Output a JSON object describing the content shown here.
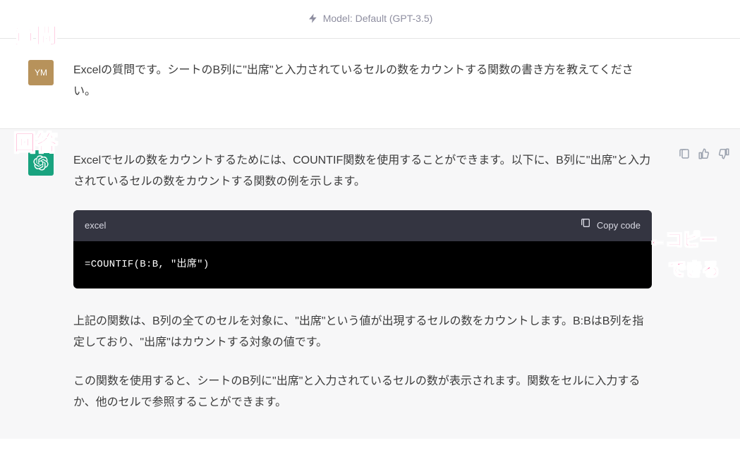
{
  "model_bar": {
    "label": "Model: Default (GPT-3.5)"
  },
  "user": {
    "avatar_text": "YM",
    "message": "Excelの質問です。シートのB列に\"出席\"と入力されているセルの数をカウントする関数の書き方を教えてください。"
  },
  "assistant": {
    "p1": "Excelでセルの数をカウントするためには、COUNTIF関数を使用することができます。以下に、B列に\"出席\"と入力されているセルの数をカウントする関数の例を示します。",
    "code": {
      "lang": "excel",
      "copy_label": "Copy code",
      "content": "=COUNTIF(B:B, \"出席\")"
    },
    "p2": "上記の関数は、B列の全てのセルを対象に、\"出席\"という値が出現するセルの数をカウントします。B:BはB列を指定しており、\"出席\"はカウントする対象の値です。",
    "p3": "この関数を使用すると、シートのB列に\"出席\"と入力されているセルの数が表示されます。関数をセルに入力するか、他のセルで参照することができます。"
  },
  "annotations": {
    "question": "質問",
    "answer": "回答",
    "copy_arrow": "←コピー",
    "copy_can": "できる"
  }
}
